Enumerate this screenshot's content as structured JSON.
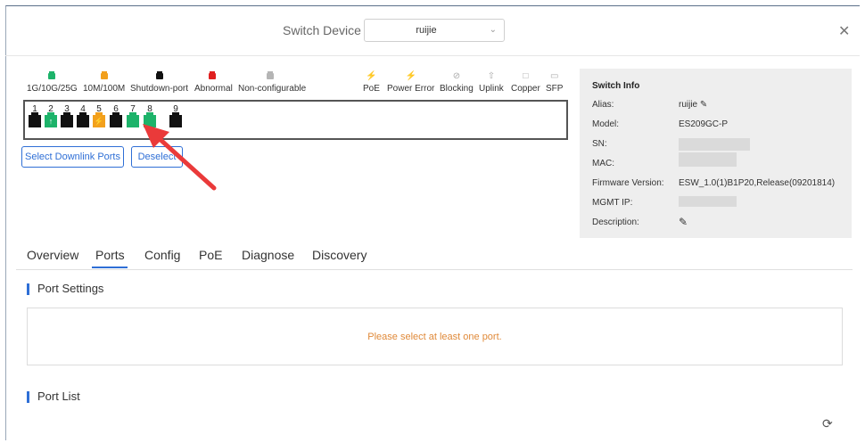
{
  "header": {
    "title": "Switch Device",
    "device": "ruijie"
  },
  "legend": [
    {
      "label": "1G/10G/25G",
      "color": "#1db36a"
    },
    {
      "label": "10M/100M",
      "color": "#f2a01c"
    },
    {
      "label": "Shutdown-port",
      "color": "#111111"
    },
    {
      "label": "Abnormal",
      "color": "#e02020"
    },
    {
      "label": "Non-configurable",
      "color": "#b5b5b5"
    }
  ],
  "icon_legend": [
    {
      "label": "PoE",
      "icon": "poe-icon",
      "glyph": "⚡"
    },
    {
      "label": "Power Error",
      "icon": "power-error-icon",
      "glyph": "⚡"
    },
    {
      "label": "Blocking",
      "icon": "blocking-icon",
      "glyph": "⊘"
    },
    {
      "label": "Uplink",
      "icon": "uplink-icon",
      "glyph": "⇧"
    },
    {
      "label": "Copper",
      "icon": "copper-icon",
      "glyph": "□"
    },
    {
      "label": "SFP",
      "icon": "sfp-icon",
      "glyph": "▭"
    }
  ],
  "ports": [
    {
      "num": "1",
      "color": "#111111",
      "glyph": ""
    },
    {
      "num": "2",
      "color": "#1db36a",
      "glyph": "↑"
    },
    {
      "num": "3",
      "color": "#111111",
      "glyph": ""
    },
    {
      "num": "4",
      "color": "#111111",
      "glyph": ""
    },
    {
      "num": "5",
      "color": "#f2a01c",
      "glyph": "⚡"
    },
    {
      "num": "6",
      "color": "#111111",
      "glyph": ""
    },
    {
      "num": "7",
      "color": "#1db36a",
      "glyph": ""
    },
    {
      "num": "8",
      "color": "#1db36a",
      "glyph": ""
    },
    {
      "num": "9",
      "color": "#111111",
      "glyph": ""
    }
  ],
  "buttons": {
    "select_downlink": "Select Downlink Ports",
    "deselect": "Deselect"
  },
  "switch_info": {
    "title": "Switch Info",
    "alias_label": "Alias:",
    "alias": "ruijie",
    "model_label": "Model:",
    "model": "ES209GC-P",
    "sn_label": "SN:",
    "mac_label": "MAC:",
    "firmware_label": "Firmware Version:",
    "firmware": "ESW_1.0(1)B1P20,Release(09201814)",
    "mgmt_label": "MGMT IP:",
    "description_label": "Description:"
  },
  "tabs": [
    "Overview",
    "Ports",
    "Config",
    "PoE",
    "Diagnose",
    "Discovery"
  ],
  "active_tab": "Ports",
  "port_settings": {
    "title": "Port Settings",
    "message": "Please select at least one port."
  },
  "port_list": {
    "title": "Port List"
  },
  "accent_color": "#2f6fd6"
}
